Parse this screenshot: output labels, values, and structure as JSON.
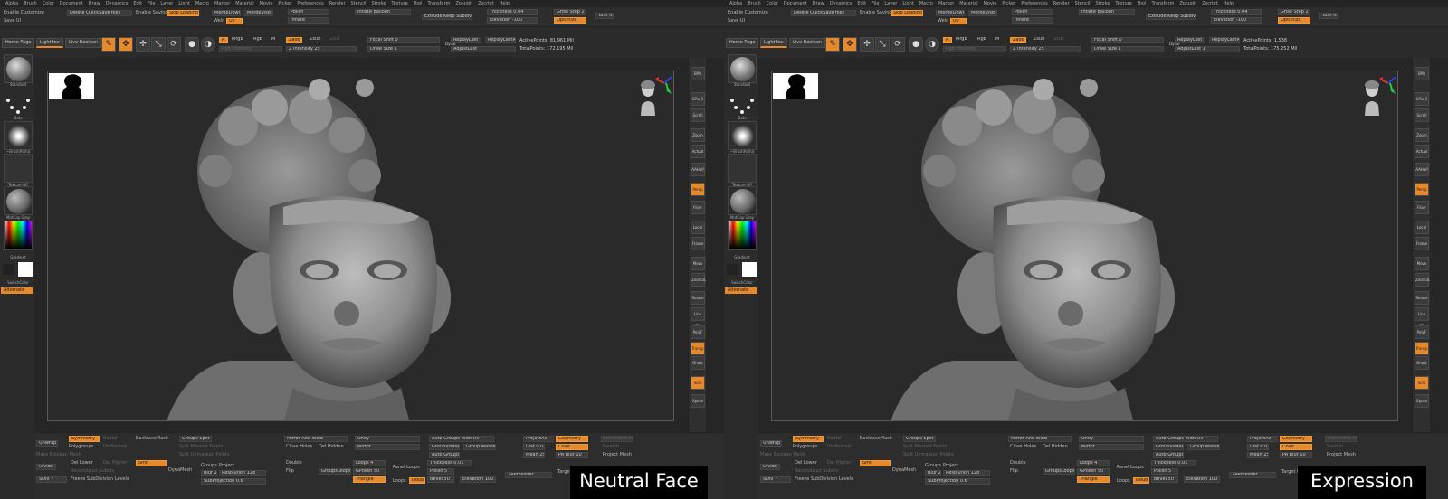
{
  "menu": [
    "Alpha",
    "Brush",
    "Color",
    "Document",
    "Draw",
    "Dynamics",
    "Edit",
    "File",
    "Layer",
    "Light",
    "Macro",
    "Marker",
    "Material",
    "Movie",
    "Picker",
    "Preferences",
    "Render",
    "Stencil",
    "Stroke",
    "Texture",
    "Tool",
    "Transform",
    "Zplugin",
    "Zscript",
    "Help"
  ],
  "top": {
    "enable_customize": "Enable Customize",
    "save_ui": "Save UI",
    "delete_quicksave": "Delete QuickSave files",
    "enable_saving": "Enable Saving",
    "skip_loading": "Skip Loading",
    "merge_down": "MergeDown",
    "merge_visible": "MergeVisible",
    "weld": "Weld",
    "uv": "Uv",
    "polish": "Polish",
    "inflate": "Inflate",
    "inflate_balloon": "Inflate Balloon",
    "extrude_keep": "Extrude Keep Subdiv",
    "thickness": "Thickness 0.04",
    "elevation": "Elevation -100",
    "grow_step": "Grow Step 2",
    "optimize": "Optimize",
    "turn_it": "Turn it"
  },
  "toolbar": {
    "home_page": "Home Page",
    "lightbox": "LightBox",
    "live_boolean": "Live Boolean",
    "edit": "Edit",
    "draw": "Draw",
    "move": "Move",
    "scale": "Scale",
    "rotate": "Rotate",
    "a": "A",
    "mrgb": "Mrgb",
    "rgb": "Rgb",
    "m": "M",
    "rgb_intensity": "Rgb Intensity",
    "zadd": "Zadd",
    "zsub": "Zsub",
    "zcut": "Zcut",
    "z_intensity": "Z Intensity 25",
    "focal_shift": "Focal Shift 0",
    "draw_size": "Draw Size 1",
    "dynamic": "Dynamic",
    "replay_last": "ReplayLast",
    "replay_last_rel": "ReplayLastRel",
    "adjust_last": "AdjustLast",
    "adjust_last_val": "AdjustLast 1"
  },
  "left": {
    "standard": "Standard",
    "dots": "Dots",
    "brush_alpha": "~BrushAlpha",
    "texture_off": "Texture Off",
    "matcap_gray": "MatCap Gray",
    "gradient": "Gradient",
    "switch_color": "SwitchColor",
    "alternate": "Alternate"
  },
  "right": [
    "BPR",
    "SPix 3",
    "Scroll",
    "Zoom",
    "Actual",
    "AAHalf",
    "Persp",
    "Floor",
    "Local",
    "Frame",
    "Move",
    "Zoom3D",
    "Rotate",
    "Line Fill",
    "PolyF",
    "Transp",
    "Ghost",
    "Solo",
    "Xpose"
  ],
  "bottom": {
    "unwrap": "Unwrap",
    "symmetry": "Symmetry",
    "polygroups": "Polygroups",
    "radial": "Radial",
    "unmasked": "UnMasked",
    "make_boolean_mesh": "Make Boolean Mesh",
    "backface_mask": "BackfaceMask",
    "divide": "Divide",
    "del_lower": "Del Lower",
    "del_higher": "Del Higher",
    "reconstruct": "Reconstruct Subdiv",
    "smt": "Smt",
    "sdiv": "SDiv 7",
    "freeze": "Freeze SubDivision Levels",
    "groups_split": "Groups Split",
    "split_masked": "Split Masked Points",
    "split_unmasked": "Split Unmasked Points",
    "dynamesh": "DynaMesh",
    "groups": "Groups",
    "project": "Project",
    "blur": "Blur 2",
    "resolution": "Resolution 128",
    "subprojection": "SubProjection 0.6",
    "mirror_weld": "Mirror And Weld",
    "close_holes": "Close Holes",
    "del_hidden": "Del Hidden",
    "double": "Double",
    "flip": "Flip",
    "groups_loops": "GroupsLoops",
    "unify": "Unify",
    "mirror": "Mirror",
    "loops": "Loops 4",
    "gpolish": "GPolish 50",
    "triangle": "Triangle",
    "panel_loops": "Panel Loops",
    "polish": "Polish 5",
    "loops_btn": "Loops",
    "double_btn": "Double",
    "auto_groups_uv": "Auto Groups With UV",
    "group_visible": "GroupVisible",
    "group_masked": "Group Masked",
    "auto_groups": "Auto Groups",
    "thickness": "Thickness 0.01",
    "bevel": "Bevel 50",
    "elevation": "Elevation 100",
    "project_all": "ProjectAll",
    "dist": "Dist 0.02",
    "mean": "Mean 25",
    "geometry": "Geometry",
    "color": "Color",
    "pa_blur": "PA Blur 10",
    "zremesher": "ZRemesher",
    "target": "Target Polygons",
    "decimate": "DecimateCurrent",
    "swatch": "Swatch",
    "project_mesh": "Project Mesh"
  },
  "left_pane": {
    "active_points": "ActivePoints: 81.961 Mil",
    "total_points": "TotalPoints: 172.195 Mil",
    "caption": "Neutral Face"
  },
  "right_pane": {
    "active_points": "ActivePoints: 1.538",
    "total_points": "TotalPoints: 175.252 Mil",
    "caption": "Expression"
  },
  "colors": {
    "accent": "#e6882c",
    "bg": "#2a2a2a",
    "canvas": "#262626"
  }
}
